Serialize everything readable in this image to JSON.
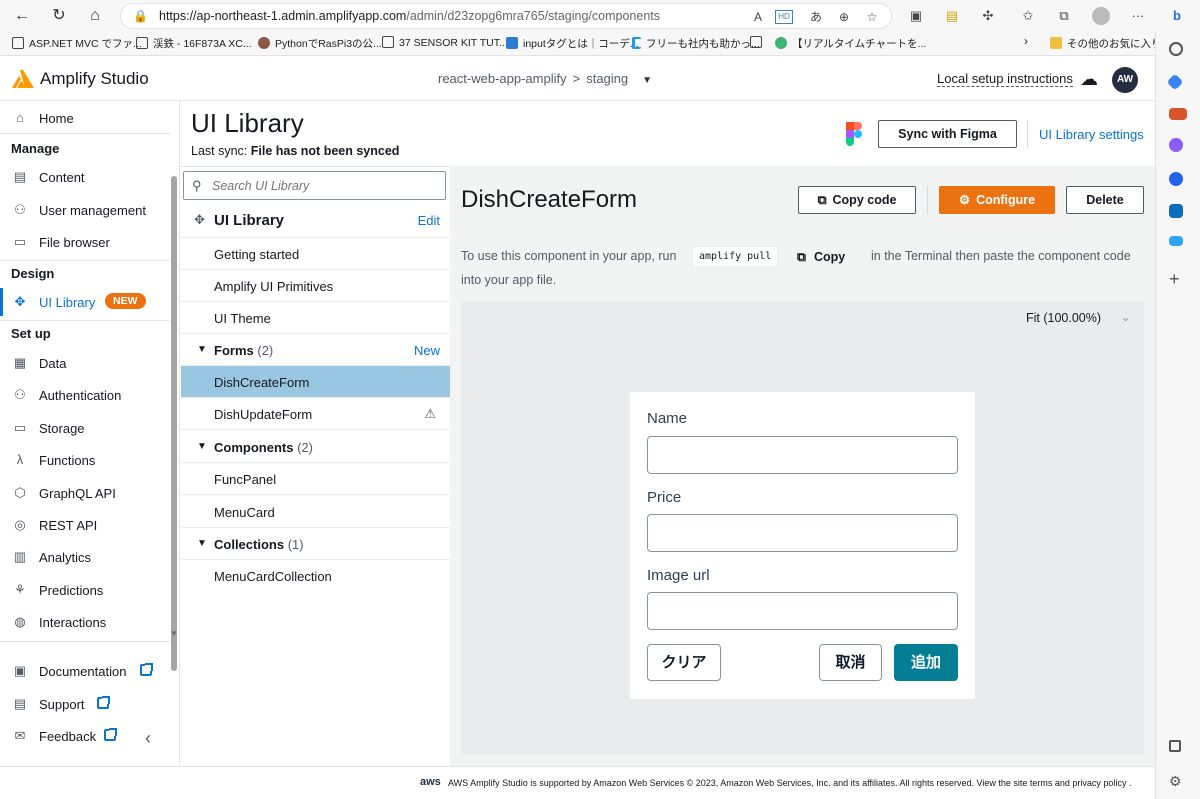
{
  "browser": {
    "url_main": "https://ap-northeast-1.admin.amplifyapp.com",
    "url_path": "/admin/d23zopg6mra765/staging/components",
    "bookmarks": [
      {
        "label": "ASP.NET MVC でファ...",
        "color": "#ffffff"
      },
      {
        "label": "渓鉄 - 16F873A XC...",
        "color": "#ffffff"
      },
      {
        "label": "PythonでRasPi3の公...",
        "color": "#8a5a44"
      },
      {
        "label": "37 SENSOR KIT TUT...",
        "color": "#ffffff"
      },
      {
        "label": "inputタグとは｜コーデ...",
        "color": "#2b7bd1"
      },
      {
        "label": "フリーも社内も助かっ...",
        "color": "#1a9be8"
      },
      {
        "label": "【リアルタイムチャートを...",
        "color": "#ffffff"
      },
      {
        "label": "【リアルタイムチャートを...",
        "color": "#3cb371"
      },
      {
        "label": "その他のお気に入り",
        "color": "#f0c040"
      }
    ]
  },
  "app": {
    "brand": "Amplify Studio",
    "crumb_app": "react-web-app-amplify",
    "crumb_sep": ">",
    "crumb_env": "staging",
    "local_setup": "Local setup instructions",
    "avatar": "AW"
  },
  "sidenav": {
    "home": "Home",
    "manage_title": "Manage",
    "content": "Content",
    "user_management": "User management",
    "file_browser": "File browser",
    "design_title": "Design",
    "ui_library": "UI Library",
    "new_badge": "NEW",
    "setup_title": "Set up",
    "data": "Data",
    "authentication": "Authentication",
    "storage": "Storage",
    "functions": "Functions",
    "graphql": "GraphQL API",
    "rest": "REST API",
    "analytics": "Analytics",
    "predictions": "Predictions",
    "interactions": "Interactions",
    "documentation": "Documentation",
    "support": "Support",
    "feedback": "Feedback"
  },
  "header": {
    "title": "UI Library",
    "last_sync_label": "Last sync:",
    "last_sync_value": "File has not been synced",
    "sync_button": "Sync with Figma",
    "settings_link": "UI Library settings"
  },
  "library": {
    "search_placeholder": "Search UI Library",
    "root_label": "UI Library",
    "edit": "Edit",
    "getting_started": "Getting started",
    "primitives": "Amplify UI Primitives",
    "theme": "UI Theme",
    "forms": "Forms",
    "forms_count": "(2)",
    "new_link": "New",
    "form1": "DishCreateForm",
    "form2": "DishUpdateForm",
    "components": "Components",
    "components_count": "(2)",
    "comp1": "FuncPanel",
    "comp2": "MenuCard",
    "collections": "Collections",
    "collections_count": "(1)",
    "coll1": "MenuCardCollection"
  },
  "detail": {
    "title": "DishCreateForm",
    "copy_code": "Copy code",
    "configure": "Configure",
    "delete": "Delete",
    "help_prefix": "To use this component in your app, run",
    "command": "amplify pull",
    "copy": "Copy",
    "help_suffix": "in the Terminal then paste the component code",
    "help_line2": "into your app file.",
    "zoom": "Fit (100.00%)"
  },
  "form_preview": {
    "name_label": "Name",
    "price_label": "Price",
    "image_label": "Image url",
    "clear": "クリア",
    "cancel": "取消",
    "add": "追加"
  },
  "footer": {
    "aws": "aws",
    "text": "AWS Amplify Studio is supported by Amazon Web Services © 2023, Amazon Web Services, Inc. and its affiliates. All rights reserved. View the site terms and privacy policy ."
  }
}
